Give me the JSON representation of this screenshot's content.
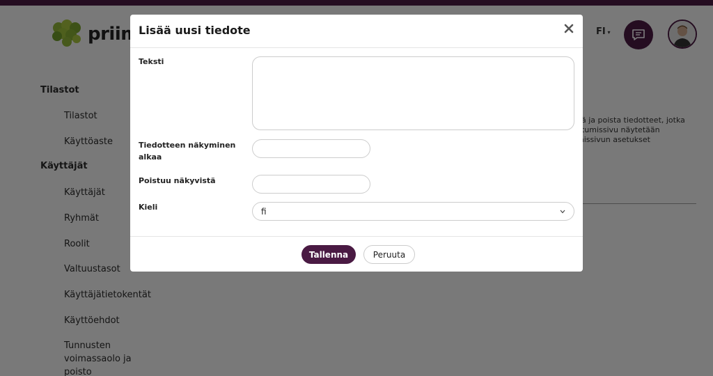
{
  "header": {
    "logo_text": "priim",
    "language": "FI",
    "chat_icon": "chat-bubble-icon",
    "avatar_icon": "user-avatar-icon"
  },
  "sidebar": {
    "sections": [
      {
        "label": "Tilastot",
        "items": [
          "Tilastot",
          "Käyttöaste"
        ]
      },
      {
        "label": "Käyttäjät",
        "items": [
          "Käyttäjät",
          "Ryhmät",
          "Roolit",
          "Valtuustasot",
          "Käyttäjätietokentät",
          "Käyttöehdot",
          "Tunnusten voimassaolo ja poisto"
        ]
      }
    ]
  },
  "background": {
    "description_lines": [
      "hä ja poista tiedotteet, jotka",
      "utumissivu näytetään",
      "missivun asetukset"
    ]
  },
  "modal": {
    "title": "Lisää uusi tiedote",
    "close_icon": "close-icon",
    "fields": {
      "text_label": "Teksti",
      "text_value": "",
      "start_label_line1": "Tiedotteen näkyminen",
      "start_label_line2": "alkaa",
      "start_value": "",
      "end_label": "Poistuu näkyvistä",
      "end_value": "",
      "language_label": "Kieli",
      "language_value": "fi"
    },
    "buttons": {
      "save": "Tallenna",
      "cancel": "Peruuta"
    }
  },
  "colors": {
    "brand": "#4a1a43",
    "overlay": "rgba(0,0,0,0.5)"
  }
}
